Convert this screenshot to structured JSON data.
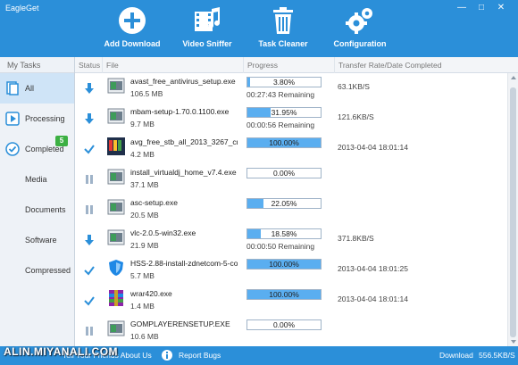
{
  "app": {
    "title": "EagleGet"
  },
  "toolbar": {
    "add_download": "Add Download",
    "video_sniffer": "Video Sniffer",
    "task_cleaner": "Task Cleaner",
    "configuration": "Configuration"
  },
  "sidebar": {
    "header": "My Tasks",
    "all": "All",
    "processing": "Processing",
    "completed": "Completed",
    "completed_badge": "5",
    "media": "Media",
    "documents": "Documents",
    "software": "Software",
    "compressed": "Compressed"
  },
  "columns": {
    "status": "Status",
    "file": "File",
    "progress": "Progress",
    "rate": "Transfer Rate/Date Completed"
  },
  "rows": [
    {
      "status": "downloading",
      "icon": "installer-icon",
      "name": "avast_free_antivirus_setup.exe",
      "size": "106.5 MB",
      "percent": 3.8,
      "progress_label": "3.80%",
      "remaining": "00:27:43 Remaining",
      "rate": "63.1KB/S"
    },
    {
      "status": "downloading",
      "icon": "installer-icon",
      "name": "mbam-setup-1.70.0.1100.exe",
      "size": "9.7 MB",
      "percent": 31.95,
      "progress_label": "31.95%",
      "remaining": "00:00:56 Remaining",
      "rate": "121.6KB/S"
    },
    {
      "status": "completed",
      "icon": "avg-icon",
      "name": "avg_free_stb_all_2013_3267_cnet.",
      "size": "4.2 MB",
      "percent": 100,
      "progress_label": "100.00%",
      "remaining": "",
      "rate": "2013-04-04 18:01:14"
    },
    {
      "status": "paused",
      "icon": "installer-icon",
      "name": "install_virtualdj_home_v7.4.exe",
      "size": "37.1 MB",
      "percent": 0,
      "progress_label": "0.00%",
      "remaining": "",
      "rate": ""
    },
    {
      "status": "paused",
      "icon": "installer-icon",
      "name": "asc-setup.exe",
      "size": "20.5 MB",
      "percent": 22.05,
      "progress_label": "22.05%",
      "remaining": "",
      "rate": ""
    },
    {
      "status": "downloading",
      "icon": "installer-icon",
      "name": "vlc-2.0.5-win32.exe",
      "size": "21.9 MB",
      "percent": 18.58,
      "progress_label": "18.58%",
      "remaining": "00:00:50 Remaining",
      "rate": "371.8KB/S"
    },
    {
      "status": "completed",
      "icon": "hotspot-shield-icon",
      "name": "HSS-2.88-install-zdnetcom-5-co",
      "size": "5.7 MB",
      "percent": 100,
      "progress_label": "100.00%",
      "remaining": "",
      "rate": "2013-04-04 18:01:25"
    },
    {
      "status": "completed",
      "icon": "winrar-icon",
      "name": "wrar420.exe",
      "size": "1.4 MB",
      "percent": 100,
      "progress_label": "100.00%",
      "remaining": "",
      "rate": "2013-04-04 18:01:14"
    },
    {
      "status": "paused",
      "icon": "installer-icon",
      "name": "GOMPLAYERENSETUP.EXE",
      "size": "10.6 MB",
      "percent": 0,
      "progress_label": "0.00%",
      "remaining": "",
      "rate": ""
    }
  ],
  "statusbar": {
    "share": "Tell Your Friends About Us",
    "report_bugs": "Report Bugs",
    "download_label": "Download",
    "download_rate": "556.5KB/S"
  },
  "watermark": "ALIN.MIYANALI.COM",
  "colors": {
    "accent": "#2b8fd9",
    "progress_fill": "#5aaef0",
    "badge": "#3cb043"
  }
}
